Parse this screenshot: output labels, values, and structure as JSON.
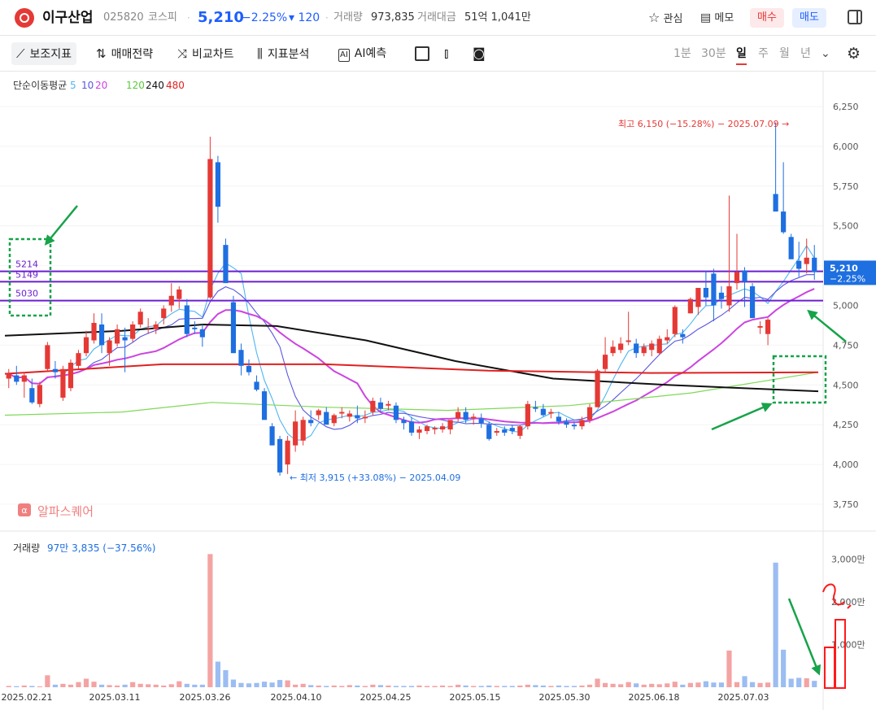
{
  "header": {
    "name": "이구산업",
    "code": "025820",
    "market": "코스피",
    "price": "5,210",
    "change_rate": "−2.25%",
    "change_amount": "▾ 120",
    "volume_label": "거래량",
    "volume": "973,835",
    "amount_label": "거래대금",
    "amount": "51억 1,041만",
    "favorite": "관심",
    "memo": "메모",
    "buy": "매수",
    "sell": "매도"
  },
  "toolbar": {
    "aux": "보조지표",
    "strategy": "매매전략",
    "compare": "비교차트",
    "analysis": "지표분석",
    "ai": "AI예측",
    "periods": [
      "1분",
      "30분",
      "일",
      "주",
      "월",
      "년"
    ],
    "active_period": "일"
  },
  "colors": {
    "up": "#e53935",
    "down": "#1e6fe0",
    "ma5": "#4fb6f0",
    "ma10": "#5a55e0",
    "ma20": "#cc44e0",
    "ma120": "#7ed957",
    "ma240": "#111111",
    "ma480": "#e02020",
    "level_line": "#6a1fd1",
    "annotation": "#17a34a"
  },
  "chart_data": {
    "type": "candlestick",
    "ma_legend": {
      "label": "단순이동평균",
      "periods": [
        "5",
        "10",
        "20",
        "120",
        "240",
        "480"
      ]
    },
    "y_ticks": [
      "6,250",
      "6,000",
      "5,750",
      "5,500",
      "5,250",
      "5,000",
      "4,750",
      "4,500",
      "4,250",
      "4,000",
      "3,750"
    ],
    "ylim": [
      3700,
      6450
    ],
    "x_ticks": [
      "2025.02.21",
      "2025.03.11",
      "2025.03.26",
      "2025.04.10",
      "2025.04.25",
      "2025.05.15",
      "2025.05.30",
      "2025.06.18",
      "2025.07.03"
    ],
    "high_label": "최고 6,150 (−15.28%) − 2025.07.09",
    "low_label": "최저 3,915 (+33.08%) − 2025.04.09",
    "current_price": "5,210",
    "current_change": "−2.25%",
    "level_lines": [
      {
        "label": "5214",
        "value": 5214
      },
      {
        "label": "5149",
        "value": 5149
      },
      {
        "label": "5030",
        "value": 5030
      }
    ],
    "watermark": "알파스퀘어",
    "candles": [
      [
        4540,
        4600,
        4480,
        4570
      ],
      [
        4560,
        4620,
        4500,
        4520
      ],
      [
        4520,
        4580,
        4420,
        4560
      ],
      [
        4480,
        4540,
        4380,
        4390
      ],
      [
        4380,
        4520,
        4360,
        4500
      ],
      [
        4600,
        4770,
        4580,
        4750
      ],
      [
        4600,
        4650,
        4540,
        4580
      ],
      [
        4420,
        4620,
        4400,
        4600
      ],
      [
        4480,
        4660,
        4460,
        4640
      ],
      [
        4620,
        4720,
        4600,
        4700
      ],
      [
        4700,
        4840,
        4680,
        4800
      ],
      [
        4780,
        4950,
        4760,
        4890
      ],
      [
        4880,
        4950,
        4700,
        4750
      ],
      [
        4700,
        4800,
        4620,
        4780
      ],
      [
        4760,
        4880,
        4740,
        4850
      ],
      [
        4800,
        4860,
        4580,
        4780
      ],
      [
        4790,
        4900,
        4770,
        4880
      ],
      [
        4880,
        4980,
        4860,
        4960
      ],
      [
        4860,
        4920,
        4820,
        4860
      ],
      [
        4850,
        4900,
        4820,
        4880
      ],
      [
        4920,
        5000,
        4880,
        4980
      ],
      [
        5000,
        5140,
        4960,
        5060
      ],
      [
        5040,
        5120,
        4980,
        5100
      ],
      [
        5000,
        5040,
        4800,
        4820
      ],
      [
        4860,
        4900,
        4820,
        4850
      ],
      [
        4850,
        4880,
        4740,
        4800
      ],
      [
        5050,
        6060,
        5040,
        5920
      ],
      [
        5900,
        5940,
        5520,
        5620
      ],
      [
        5380,
        5420,
        5150,
        5140
      ],
      [
        5020,
        5060,
        4700,
        4700
      ],
      [
        4720,
        4760,
        4560,
        4620
      ],
      [
        4620,
        4660,
        4560,
        4580
      ],
      [
        4520,
        4560,
        4460,
        4470
      ],
      [
        4460,
        4480,
        4360,
        4280
      ],
      [
        4240,
        4260,
        4120,
        4120
      ],
      [
        4160,
        4180,
        3930,
        3950
      ],
      [
        4000,
        4180,
        3940,
        4150
      ],
      [
        4120,
        4340,
        4080,
        4270
      ],
      [
        4150,
        4300,
        4120,
        4280
      ],
      [
        4280,
        4340,
        4240,
        4260
      ],
      [
        4310,
        4350,
        4280,
        4340
      ],
      [
        4330,
        4360,
        4280,
        4250
      ],
      [
        4260,
        4320,
        4240,
        4310
      ],
      [
        4320,
        4360,
        4290,
        4330
      ],
      [
        4300,
        4340,
        4270,
        4320
      ],
      [
        4310,
        4370,
        4260,
        4290
      ],
      [
        4290,
        4340,
        4260,
        4300
      ],
      [
        4330,
        4420,
        4310,
        4400
      ],
      [
        4390,
        4420,
        4330,
        4350
      ],
      [
        4370,
        4400,
        4340,
        4380
      ],
      [
        4370,
        4390,
        4260,
        4280
      ],
      [
        4280,
        4300,
        4220,
        4260
      ],
      [
        4270,
        4300,
        4180,
        4200
      ],
      [
        4200,
        4240,
        4160,
        4220
      ],
      [
        4210,
        4250,
        4190,
        4240
      ],
      [
        4220,
        4240,
        4190,
        4230
      ],
      [
        4220,
        4260,
        4200,
        4240
      ],
      [
        4220,
        4260,
        4190,
        4280
      ],
      [
        4290,
        4360,
        4270,
        4330
      ],
      [
        4330,
        4360,
        4260,
        4280
      ],
      [
        4290,
        4320,
        4250,
        4300
      ],
      [
        4290,
        4320,
        4230,
        4260
      ],
      [
        4250,
        4270,
        4150,
        4160
      ],
      [
        4200,
        4230,
        4180,
        4210
      ],
      [
        4220,
        4240,
        4180,
        4200
      ],
      [
        4230,
        4250,
        4190,
        4210
      ],
      [
        4180,
        4250,
        4160,
        4240
      ],
      [
        4240,
        4400,
        4220,
        4380
      ],
      [
        4360,
        4400,
        4330,
        4350
      ],
      [
        4350,
        4380,
        4300,
        4310
      ],
      [
        4320,
        4350,
        4290,
        4330
      ],
      [
        4300,
        4330,
        4250,
        4270
      ],
      [
        4270,
        4290,
        4230,
        4250
      ],
      [
        4250,
        4270,
        4220,
        4240
      ],
      [
        4240,
        4300,
        4220,
        4280
      ],
      [
        4280,
        4380,
        4260,
        4360
      ],
      [
        4360,
        4600,
        4360,
        4590
      ],
      [
        4600,
        4800,
        4580,
        4690
      ],
      [
        4700,
        4780,
        4680,
        4740
      ],
      [
        4720,
        4800,
        4700,
        4760
      ],
      [
        4770,
        4960,
        4750,
        4780
      ],
      [
        4760,
        4790,
        4670,
        4700
      ],
      [
        4700,
        4760,
        4680,
        4740
      ],
      [
        4720,
        4780,
        4680,
        4760
      ],
      [
        4700,
        4810,
        4690,
        4790
      ],
      [
        4780,
        4850,
        4760,
        4800
      ],
      [
        4820,
        5000,
        4800,
        4990
      ],
      [
        4820,
        4850,
        4760,
        4800
      ],
      [
        4950,
        5050,
        4950,
        5040
      ],
      [
        4990,
        5060,
        4940,
        5110
      ],
      [
        5110,
        5220,
        5000,
        5050
      ],
      [
        5200,
        5230,
        4900,
        5000
      ],
      [
        5080,
        5120,
        4980,
        5040
      ],
      [
        5000,
        5690,
        4960,
        5120
      ],
      [
        5140,
        5450,
        5100,
        5210
      ],
      [
        5220,
        5240,
        4990,
        5150
      ],
      [
        5120,
        5140,
        4920,
        4920
      ],
      [
        4860,
        4900,
        4820,
        4870
      ],
      [
        4820,
        4920,
        4750,
        4910
      ],
      [
        5700,
        6150,
        5600,
        5590
      ],
      [
        5590,
        5900,
        5450,
        5460
      ],
      [
        5430,
        5450,
        5320,
        5290
      ],
      [
        5280,
        5400,
        5180,
        5230
      ],
      [
        5260,
        5420,
        5200,
        5300
      ],
      [
        5300,
        5380,
        5160,
        5210
      ]
    ],
    "volume_label": "거래량",
    "volume_value": "97만 3,835 (−37.56%)",
    "volume_ticks": [
      "3,000만",
      "2,000만",
      "1,000만"
    ],
    "volume": [
      30,
      25,
      40,
      30,
      20,
      280,
      60,
      80,
      60,
      120,
      200,
      130,
      60,
      50,
      40,
      60,
      120,
      80,
      70,
      60,
      40,
      70,
      140,
      80,
      60,
      60,
      3120,
      600,
      400,
      180,
      100,
      90,
      100,
      130,
      110,
      170,
      160,
      60,
      80,
      50,
      40,
      30,
      40,
      30,
      50,
      40,
      30,
      60,
      50,
      40,
      30,
      30,
      30,
      40,
      30,
      30,
      40,
      30,
      60,
      40,
      30,
      30,
      40,
      30,
      30,
      30,
      40,
      60,
      50,
      40,
      30,
      40,
      30,
      30,
      40,
      60,
      200,
      100,
      80,
      70,
      120,
      90,
      60,
      80,
      70,
      90,
      130,
      60,
      100,
      110,
      140,
      110,
      110,
      860,
      120,
      260,
      120,
      100,
      110,
      2920,
      880,
      200,
      220,
      210,
      150
    ]
  }
}
